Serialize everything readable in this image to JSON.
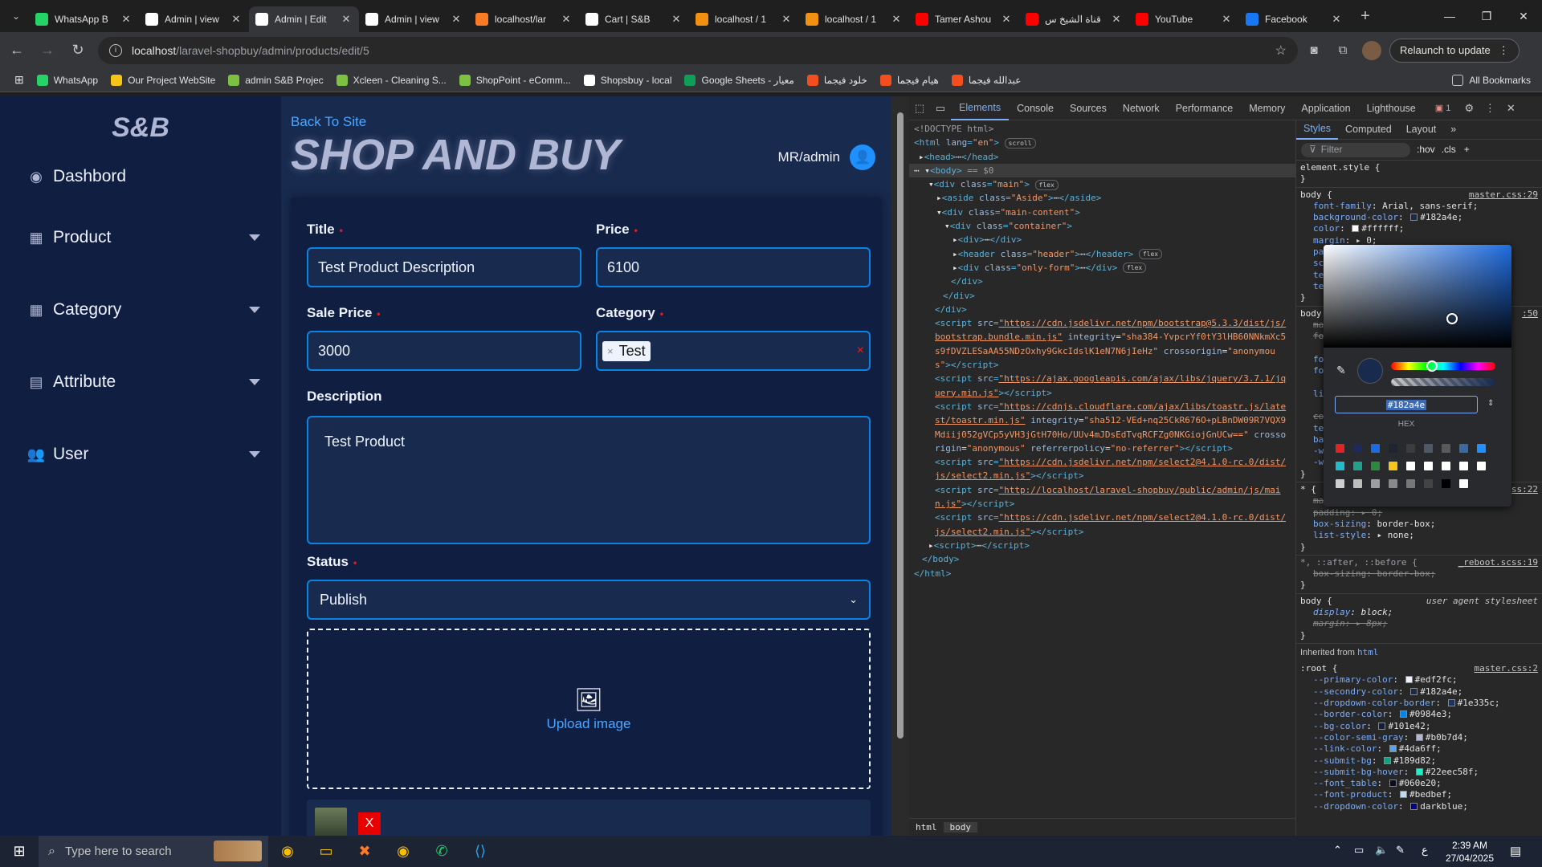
{
  "browser": {
    "tabs": [
      {
        "title": "WhatsApp B",
        "icon": "whatsapp-icon",
        "color": "#25d366",
        "active": false
      },
      {
        "title": "Admin | view",
        "icon": "sb-icon",
        "color": "#ffffff",
        "active": false
      },
      {
        "title": "Admin | Edit",
        "icon": "sb-icon",
        "color": "#ffffff",
        "active": true
      },
      {
        "title": "Admin | view",
        "icon": "sb-icon",
        "color": "#ffffff",
        "active": false
      },
      {
        "title": "localhost/lar",
        "icon": "xampp-icon",
        "color": "#fb7a24",
        "active": false
      },
      {
        "title": "Cart | S&B",
        "icon": "sb-icon",
        "color": "#ffffff",
        "active": false
      },
      {
        "title": "localhost / 1",
        "icon": "phpmyadmin-icon",
        "color": "#f29111",
        "active": false
      },
      {
        "title": "localhost / 1",
        "icon": "phpmyadmin-icon",
        "color": "#f29111",
        "active": false
      },
      {
        "title": "Tamer Ashou",
        "icon": "youtube-icon",
        "color": "#ff0000",
        "active": false
      },
      {
        "title": "قناة الشيخ س",
        "icon": "youtube-icon",
        "color": "#ff0000",
        "active": false
      },
      {
        "title": "YouTube",
        "icon": "youtube-icon",
        "color": "#ff0000",
        "active": false
      },
      {
        "title": "Facebook",
        "icon": "facebook-icon",
        "color": "#1877f2",
        "active": false
      }
    ],
    "url_host": "localhost",
    "url_path": "/laravel-shopbuy/admin/products/edit/5",
    "relaunch_label": "Relaunch to update",
    "bookmarks": [
      {
        "label": "WhatsApp",
        "color": "#25d366"
      },
      {
        "label": "Our Project WebSite",
        "color": "#f5c518"
      },
      {
        "label": "admin S&B Projec",
        "color": "#7cc142"
      },
      {
        "label": "Xcleen - Cleaning S...",
        "color": "#7cc142"
      },
      {
        "label": "ShopPoint - eComm...",
        "color": "#7cc142"
      },
      {
        "label": "Shopsbuy - local",
        "color": "#ffffff"
      },
      {
        "label": "Google Sheets - معيار",
        "color": "#0f9d58"
      },
      {
        "label": "خلود فيجما",
        "color": "#f24e1e"
      },
      {
        "label": "هيام فيجما",
        "color": "#f24e1e"
      },
      {
        "label": "عبدالله فيجما",
        "color": "#f24e1e"
      }
    ],
    "all_bookmarks_label": "All Bookmarks"
  },
  "sidebar": {
    "logo": "S&B",
    "items": [
      {
        "label": "Dashbord",
        "icon": "dashboard-icon",
        "has_caret": false
      },
      {
        "label": "Product",
        "icon": "boxes-icon",
        "has_caret": true
      },
      {
        "label": "Category",
        "icon": "boxes-icon",
        "has_caret": true
      },
      {
        "label": "Attribute",
        "icon": "archive-icon",
        "has_caret": true
      },
      {
        "label": "User",
        "icon": "users-icon",
        "has_caret": true
      }
    ]
  },
  "header": {
    "back_link": "Back To Site",
    "brand": "SHOP AND BUY",
    "user": "MR/admin"
  },
  "form": {
    "title_label": "Title",
    "title_value": "Test Product Description",
    "price_label": "Price",
    "price_value": "6100",
    "sale_price_label": "Sale Price",
    "sale_price_value": "3000",
    "category_label": "Category",
    "category_chip": "Test",
    "description_label": "Description",
    "description_value": "Test Product",
    "status_label": "Status",
    "status_value": "Publish",
    "upload_label": "Upload image",
    "delete_label": "X",
    "required_mark": "•"
  },
  "devtools": {
    "tabs": [
      "Elements",
      "Console",
      "Sources",
      "Network",
      "Performance",
      "Memory",
      "Application",
      "Lighthouse"
    ],
    "active_tab": "Elements",
    "issues_count": "1",
    "styles_tabs": [
      "Styles",
      "Computed",
      "Layout"
    ],
    "filter_placeholder": "Filter",
    "filter_hov": ":hov",
    "filter_cls": ".cls",
    "breadcrumb": [
      "html",
      "body"
    ],
    "picker_hex": "#182a4e",
    "picker_hex_label": "HEX",
    "palette": [
      "#e02424",
      "#1e2a5a",
      "#1e6be0",
      "#202430",
      "#3c3c3c",
      "#505868",
      "#5a5a5a",
      "#3b6aa0",
      "#1e90ff",
      "#22bbcc",
      "#23a08a",
      "#2b8a3e",
      "#f5c518",
      "#ffffff",
      "#ffffff",
      "#ffffff",
      "#ffffff",
      "#ffffff",
      "#cfcfcf",
      "#bdbdbd",
      "#9e9e9e",
      "#8a8a8a",
      "#777777",
      "#444444",
      "#000000",
      "#ffffff"
    ],
    "inherited_from": "Inherited from",
    "inherited_el": "html"
  },
  "taskbar": {
    "search_placeholder": "Type here to search",
    "time": "2:39 AM",
    "date": "27/04/2025",
    "lang": "ع"
  }
}
